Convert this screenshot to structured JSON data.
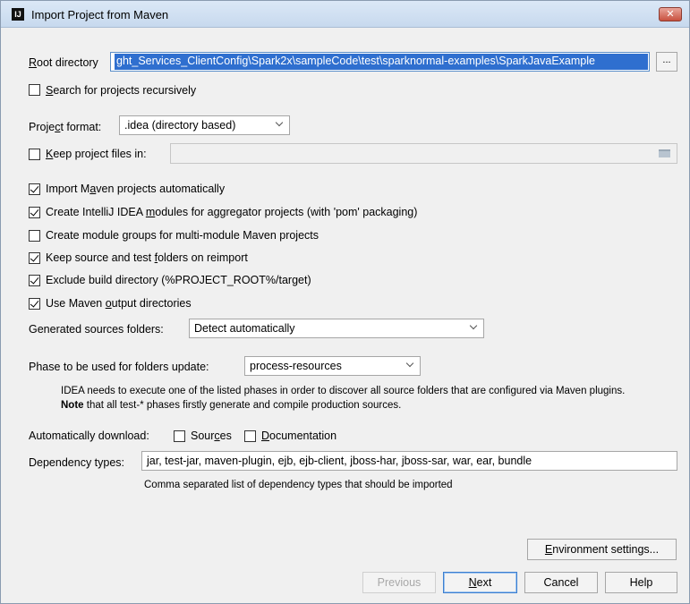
{
  "window": {
    "title": "Import Project from Maven",
    "close_label": "✕",
    "app_icon_label": "IJ"
  },
  "root": {
    "label_pre": "",
    "label_underline": "R",
    "label_post": "oot directory",
    "value": "ght_Services_ClientConfig\\Spark2x\\sampleCode\\test\\sparknormal-examples\\SparkJavaExample",
    "browse_label": "..."
  },
  "search_recursive": {
    "label_underline": "S",
    "label_post": "earch for projects recursively",
    "checked": false
  },
  "project_format": {
    "label_pre": "Proje",
    "label_underline": "c",
    "label_post": "t format:",
    "value": ".idea (directory based)"
  },
  "keep_files": {
    "label_underline": "K",
    "label_post": "eep project files in:",
    "checked": false
  },
  "options": [
    {
      "pre": "Import M",
      "u": "a",
      "post": "ven projects automatically",
      "checked": true
    },
    {
      "pre": "Create IntelliJ IDEA ",
      "u": "m",
      "post": "odules for aggregator projects (with 'pom' packaging)",
      "checked": true
    },
    {
      "pre": "Create module ",
      "u": "g",
      "post": "roups for multi-module Maven projects",
      "checked": false
    },
    {
      "pre": "Keep source and test ",
      "u": "f",
      "post": "olders on reimport",
      "checked": true
    },
    {
      "pre": "Exclude build directory (%PROJECT_ROOT%/target)",
      "u": "",
      "post": "",
      "checked": true
    },
    {
      "pre": "Use Maven ",
      "u": "o",
      "post": "utput directories",
      "checked": true
    }
  ],
  "generated_sources": {
    "label": "Generated sources folders:",
    "value": "Detect automatically"
  },
  "phase": {
    "label": "Phase to be used for folders update:",
    "value": "process-resources",
    "hint_line1": "IDEA needs to execute one of the listed phases in order to discover all source folders that are configured via Maven plugins.",
    "hint_line2_bold": "Note",
    "hint_line2_rest": " that all test-* phases firstly generate and compile production sources."
  },
  "auto_download": {
    "label": "Automatically download:",
    "sources_pre": "Sour",
    "sources_u": "c",
    "sources_post": "es",
    "sources_checked": false,
    "docs_u": "D",
    "docs_post": "ocumentation",
    "docs_checked": false
  },
  "dependency_types": {
    "label": "Dependency types:",
    "value": "jar, test-jar, maven-plugin, ejb, ejb-client, jboss-har, jboss-sar, war, ear, bundle",
    "hint": "Comma separated list of dependency types that should be imported"
  },
  "buttons": {
    "env_pre": "",
    "env_u": "E",
    "env_post": "nvironment settings...",
    "previous": "Previous",
    "next_u": "N",
    "next_post": "ext",
    "cancel": "Cancel",
    "help": "Help"
  }
}
